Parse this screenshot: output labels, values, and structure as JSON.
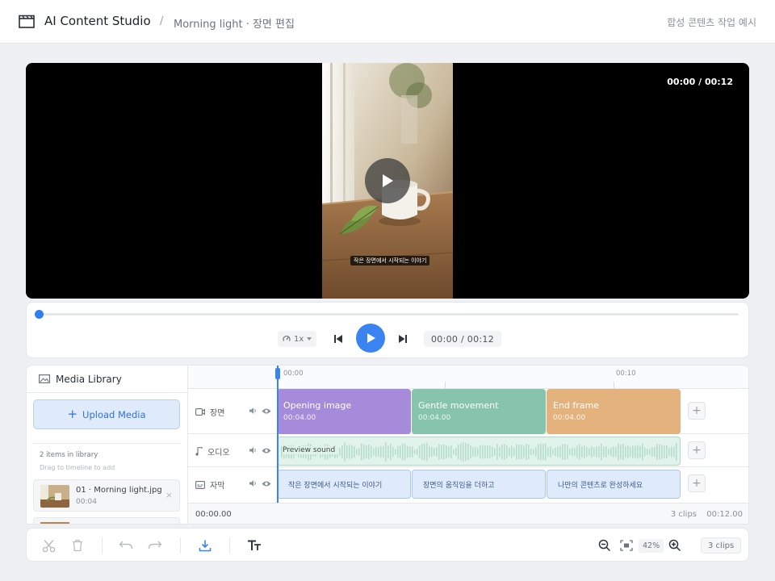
{
  "header": {
    "app_name": "AI Content Studio",
    "separator": "/",
    "breadcrumb": "Morning light · 장면 편집",
    "note": "합성 콘텐츠 작업 예시"
  },
  "player": {
    "timecode": "00:00 / 00:12",
    "subtitle": "작은 장면에서 시작되는 이야기"
  },
  "controls": {
    "speed": "1x",
    "time": "00:00 / 00:12",
    "progress": 0
  },
  "library": {
    "title": "Media Library",
    "upload_label": "Upload Media",
    "count": "2 items in library",
    "hint": "Drag to timeline to add",
    "items": [
      {
        "name": "01 · Morning light.jpg",
        "duration": "00:04",
        "remove": "×"
      }
    ]
  },
  "timeline": {
    "ticks": [
      "00:00",
      "00:10"
    ],
    "tracks": [
      {
        "label": "장면",
        "icon": "video-icon"
      },
      {
        "label": "오디오",
        "icon": "music-note-icon"
      },
      {
        "label": "자막",
        "icon": "subtitle-icon"
      }
    ],
    "scene_clips": [
      {
        "title": "Opening image",
        "duration": "00:04.00",
        "color": "#a68bdb"
      },
      {
        "title": "Gentle movement",
        "duration": "00:04.00",
        "color": "#86c4ad"
      },
      {
        "title": "End frame",
        "duration": "00:04.00",
        "color": "#e4b27c"
      }
    ],
    "audio_clip": {
      "label": "Preview sound"
    },
    "subtitle_clips": [
      {
        "text": "작은 장면에서 시작되는 이야기"
      },
      {
        "text": "장면의 움직임을 더하고"
      },
      {
        "text": "나만의 콘텐츠로 완성하세요"
      }
    ],
    "add_label": "+",
    "footer": {
      "start": "00:00.00",
      "count": "3 clips",
      "total": "00:12.00"
    }
  },
  "toolbar": {
    "zoom": "42%",
    "clip_count": "3 clips"
  },
  "colors": {
    "accent": "#3a84f2",
    "scene1": "#a68bdb",
    "scene2": "#86c4ad",
    "scene3": "#e4b27c"
  }
}
